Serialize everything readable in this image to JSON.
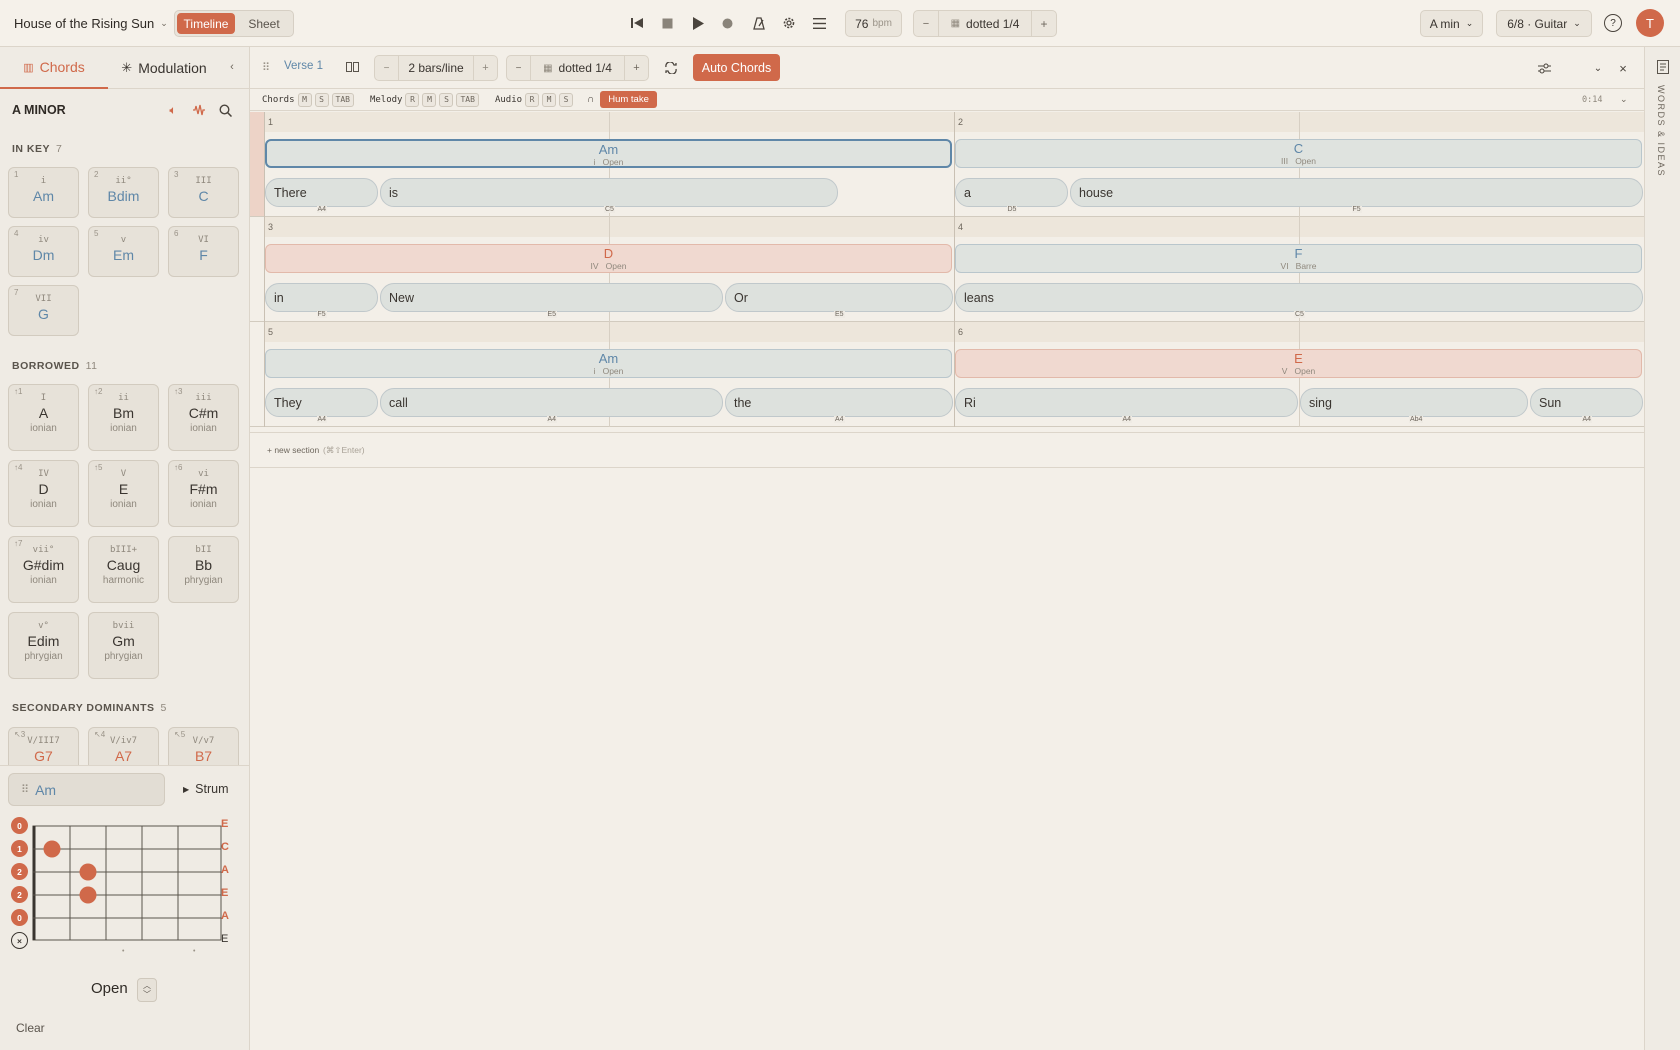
{
  "topbar": {
    "song_title": "House of the Rising Sun",
    "views": [
      "Timeline",
      "Sheet"
    ],
    "tempo_value": "76",
    "tempo_unit": "bpm",
    "grid": "dotted 1/4",
    "minus": "−",
    "plus": "+",
    "key": "A min",
    "meter_instrument": "6/8 · Guitar",
    "avatar": "T"
  },
  "sidebar": {
    "tabs": [
      "Chords",
      "Modulation"
    ],
    "key_title": "A MINOR",
    "in_key": {
      "title": "IN KEY",
      "count": "7",
      "chords": [
        {
          "n": "1",
          "r": "i",
          "c": "Am"
        },
        {
          "n": "2",
          "r": "ii°",
          "c": "Bdim"
        },
        {
          "n": "3",
          "r": "III",
          "c": "C"
        },
        {
          "n": "4",
          "r": "iv",
          "c": "Dm"
        },
        {
          "n": "5",
          "r": "v",
          "c": "Em"
        },
        {
          "n": "6",
          "r": "VI",
          "c": "F"
        },
        {
          "n": "7",
          "r": "VII",
          "c": "G"
        }
      ]
    },
    "borrowed": {
      "title": "BORROWED",
      "count": "11",
      "chords": [
        {
          "n": "↑1",
          "r": "I",
          "c": "A",
          "m": "ionian"
        },
        {
          "n": "↑2",
          "r": "ii",
          "c": "Bm",
          "m": "ionian"
        },
        {
          "n": "↑3",
          "r": "iii",
          "c": "C#m",
          "m": "ionian"
        },
        {
          "n": "↑4",
          "r": "IV",
          "c": "D",
          "m": "ionian"
        },
        {
          "n": "↑5",
          "r": "V",
          "c": "E",
          "m": "ionian"
        },
        {
          "n": "↑6",
          "r": "vi",
          "c": "F#m",
          "m": "ionian"
        },
        {
          "n": "↑7",
          "r": "vii°",
          "c": "G#dim",
          "m": "ionian"
        },
        {
          "n": "",
          "r": "bIII+",
          "c": "Caug",
          "m": "harmonic"
        },
        {
          "n": "",
          "r": "bII",
          "c": "Bb",
          "m": "phrygian"
        },
        {
          "n": "",
          "r": "v°",
          "c": "Edim",
          "m": "phrygian"
        },
        {
          "n": "",
          "r": "bvii",
          "c": "Gm",
          "m": "phrygian"
        }
      ]
    },
    "secondary": {
      "title": "SECONDARY DOMINANTS",
      "count": "5",
      "chords": [
        {
          "n": "↖3",
          "r": "V/III7",
          "c": "G7"
        },
        {
          "n": "↖4",
          "r": "V/iv7",
          "c": "A7"
        },
        {
          "n": "↖5",
          "r": "V/v7",
          "c": "B7"
        }
      ]
    },
    "selected_chord": "Am",
    "strum_label": "Strum",
    "fret_numbers": [
      "0",
      "1",
      "2",
      "2",
      "0",
      "×"
    ],
    "string_notes": [
      "E",
      "C",
      "A",
      "E",
      "A",
      "E"
    ],
    "voicing": "Open",
    "clear": "Clear"
  },
  "toolbar": {
    "section": "Verse 1",
    "bars_per_line": "2 bars/line",
    "grid": "dotted 1/4",
    "auto_chords": "Auto Chords"
  },
  "tracks": {
    "chords_label": "Chords",
    "melody_label": "Melody",
    "audio_label": "Audio",
    "chords_btns": [
      "M",
      "S",
      "TAB"
    ],
    "melody_btns": [
      "R",
      "M",
      "S",
      "TAB"
    ],
    "audio_btns": [
      "R",
      "M",
      "S"
    ],
    "hum_take": "Hum take",
    "time": "0:14"
  },
  "score": {
    "bars": [
      "1",
      "2",
      "3",
      "4",
      "5",
      "6"
    ],
    "chords": [
      {
        "name": "Am",
        "roman": "i",
        "shape": "Open"
      },
      {
        "name": "C",
        "roman": "III",
        "shape": "Open"
      },
      {
        "name": "D",
        "roman": "IV",
        "shape": "Open"
      },
      {
        "name": "F",
        "roman": "VI",
        "shape": "Barre"
      },
      {
        "name": "Am",
        "roman": "i",
        "shape": "Open"
      },
      {
        "name": "E",
        "roman": "V",
        "shape": "Open"
      }
    ],
    "lyrics": [
      {
        "w": "There",
        "n": "A4"
      },
      {
        "w": "is",
        "n": "C5"
      },
      {
        "w": "a",
        "n": "D5"
      },
      {
        "w": "house",
        "n": "F5"
      },
      {
        "w": "in",
        "n": "F5"
      },
      {
        "w": "New",
        "n": "E5"
      },
      {
        "w": "Or",
        "n": "E5"
      },
      {
        "w": "leans",
        "n": "C5"
      },
      {
        "w": "They",
        "n": "A4"
      },
      {
        "w": "call",
        "n": "A4"
      },
      {
        "w": "the",
        "n": "A4"
      },
      {
        "w": "Ri",
        "n": "A4"
      },
      {
        "w": "sing",
        "n": "Ab4"
      },
      {
        "w": "Sun",
        "n": "A4"
      }
    ],
    "new_section": "+ new section",
    "new_section_hint": "(⌘⇧Enter)"
  },
  "right_rail": {
    "label": "WORDS & IDEAS"
  },
  "colors": {
    "accent": "#d0694a",
    "blue": "#5f87a8",
    "bg": "#f3efe8"
  }
}
